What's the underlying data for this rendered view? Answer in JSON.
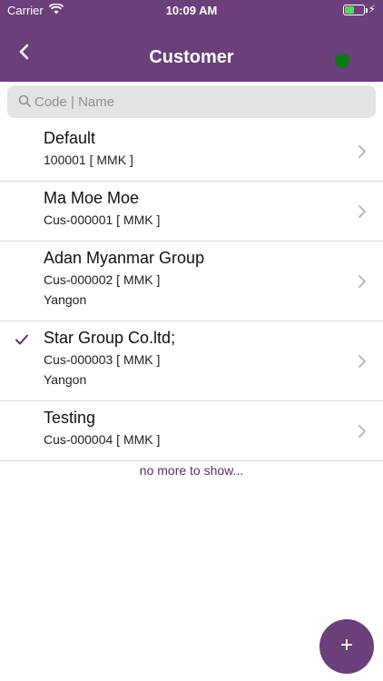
{
  "status_bar": {
    "carrier": "Carrier",
    "time": "10:09 AM",
    "wifi_icon": "wifi-icon",
    "battery_icon": "battery-icon"
  },
  "nav": {
    "title": "Customer",
    "back_icon": "chevron-left-icon",
    "status_color": "#0a7a12"
  },
  "search": {
    "placeholder": "Code | Name",
    "value": ""
  },
  "customers": [
    {
      "name": "Default",
      "code": "100001 [ MMK ]",
      "city": "",
      "selected": false
    },
    {
      "name": "Ma Moe Moe",
      "code": "Cus-000001 [ MMK ]",
      "city": "",
      "selected": false
    },
    {
      "name": "Adan Myanmar Group",
      "code": "Cus-000002 [ MMK ]",
      "city": "Yangon",
      "selected": false
    },
    {
      "name": "Star Group Co.ltd;",
      "code": "Cus-000003 [ MMK ]",
      "city": "Yangon",
      "selected": true
    },
    {
      "name": "Testing",
      "code": "Cus-000004 [ MMK ]",
      "city": "",
      "selected": false
    }
  ],
  "footer": {
    "no_more": "no more to show..."
  },
  "fab": {
    "label": "+"
  },
  "colors": {
    "primary": "#6b3f7a",
    "accent": "#5b2d6e"
  }
}
